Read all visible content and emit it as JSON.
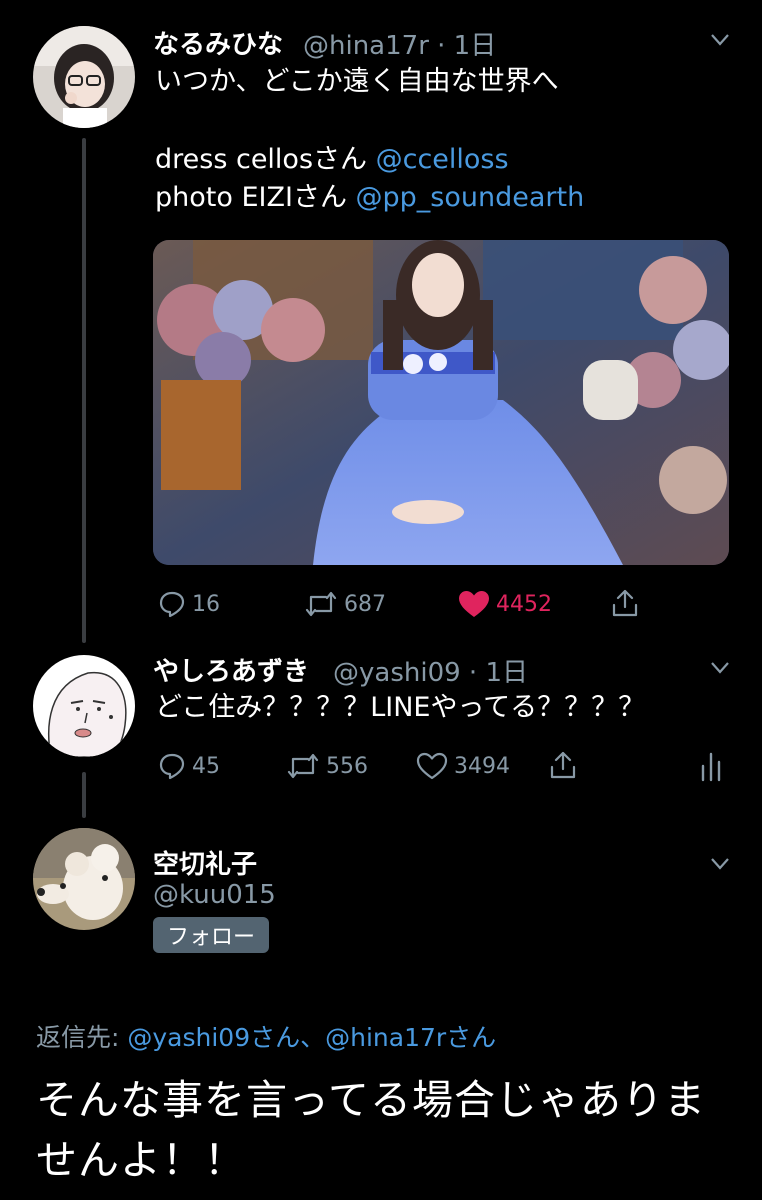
{
  "tweet1": {
    "name": "なるみひな",
    "handle_time": "@hina17r · 1日",
    "line1": "いつか、どこか遠く自由な世界へ",
    "credit1_prefix": "dress cellosさん ",
    "credit1_mention": "@ccelloss",
    "credit2_prefix": "photo EIZIさん ",
    "credit2_mention": "@pp_soundearth",
    "replies": "16",
    "retweets": "687",
    "likes": "4452"
  },
  "tweet2": {
    "name": "やしろあずき",
    "handle_time": "@yashi09 · 1日",
    "text": "どこ住み？？？？LINEやってる？？？？",
    "replies": "45",
    "retweets": "556",
    "likes": "3494"
  },
  "tweet3": {
    "name": "空切礼子",
    "handle": "@kuu015",
    "follow_label": "フォロー",
    "reply_to_label": "返信先: ",
    "reply_to_mentions": "@yashi09さん、@hina17rさん",
    "text": "そんな事を言ってる場合じゃありませんよ！！"
  },
  "icons": [
    "chevron-down-icon",
    "reply-icon",
    "retweet-icon",
    "like-icon",
    "share-icon",
    "analytics-icon"
  ],
  "colors": {
    "background": "#000000",
    "link": "#4a9ae0",
    "muted": "#8899a6",
    "like": "#e0245e"
  }
}
